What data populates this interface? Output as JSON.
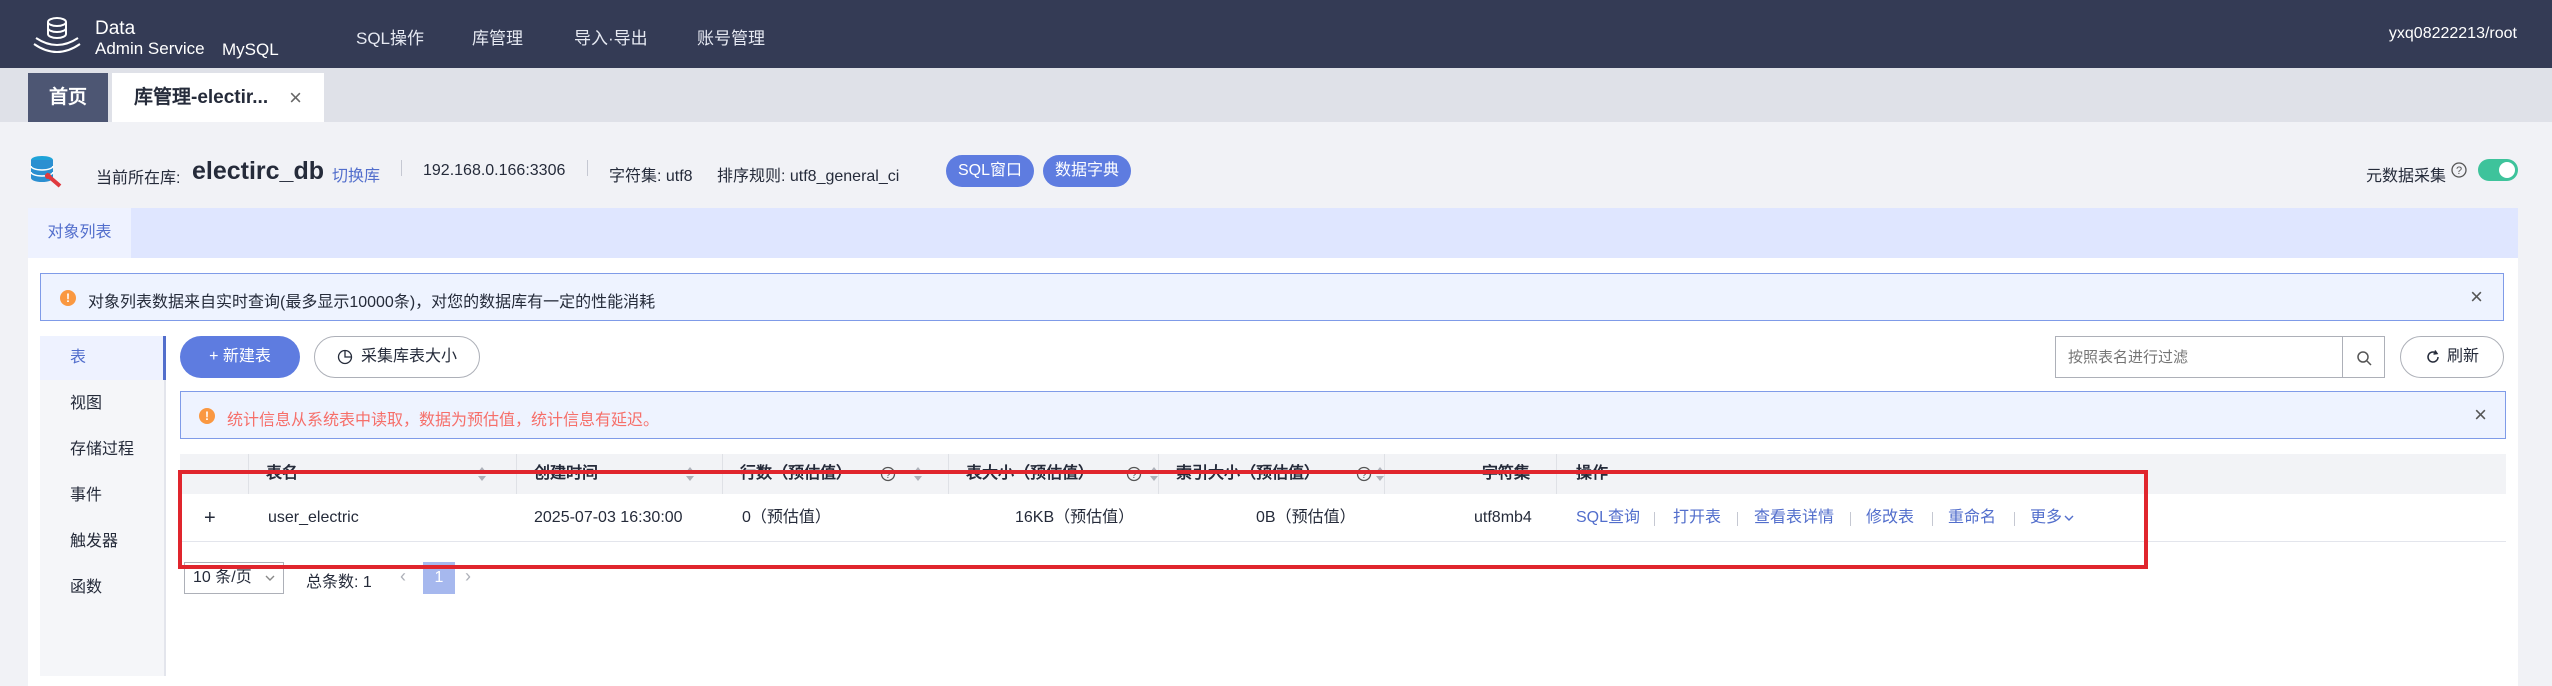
{
  "topbar": {
    "brand_line1": "Data",
    "brand_line2": "Admin Service",
    "brand_engine": "MySQL",
    "nav": [
      "SQL操作",
      "库管理",
      "导入·导出",
      "账号管理"
    ],
    "user": "yxq08222213/root"
  },
  "tabs": {
    "home": "首页",
    "active": "库管理-electir...",
    "close": "×"
  },
  "dbinfo": {
    "current_label": "当前所在库:",
    "db_name": "electirc_db",
    "switch": "切换库",
    "host": "192.168.0.166:3306",
    "charset": "字符集: utf8",
    "collation": "排序规则: utf8_general_ci",
    "btn_sql": "SQL窗口",
    "btn_dict": "数据字典",
    "meta_collect": "元数据采集",
    "meta_enabled": true
  },
  "subtab": "对象列表",
  "alert_top": "对象列表数据来自实时查询(最多显示10000条)，对您的数据库有一定的性能消耗",
  "left_menu": [
    "表",
    "视图",
    "存储过程",
    "事件",
    "触发器",
    "函数"
  ],
  "toolbar": {
    "new_table": "+ 新建表",
    "collect_size": "采集库表大小",
    "search_placeholder": "按照表名进行过滤",
    "refresh": "刷新"
  },
  "alert_stat": "统计信息从系统表中读取，数据为预估值，统计信息有延迟。",
  "table": {
    "headers": [
      "表名",
      "创建时间",
      "行数（预估值）",
      "表大小（预估值）",
      "索引大小（预估值）",
      "字符集",
      "操作"
    ],
    "rows": [
      {
        "name": "user_electric",
        "created": "2025-07-03 16:30:00",
        "rows": "0（预估值）",
        "size": "16KB（预估值）",
        "index_size": "0B（预估值）",
        "charset": "utf8mb4"
      }
    ],
    "ops": [
      "SQL查询",
      "打开表",
      "查看表详情",
      "修改表",
      "重命名",
      "更多"
    ]
  },
  "pagination": {
    "page_size": "10 条/页",
    "total": "总条数: 1",
    "current": "1"
  }
}
